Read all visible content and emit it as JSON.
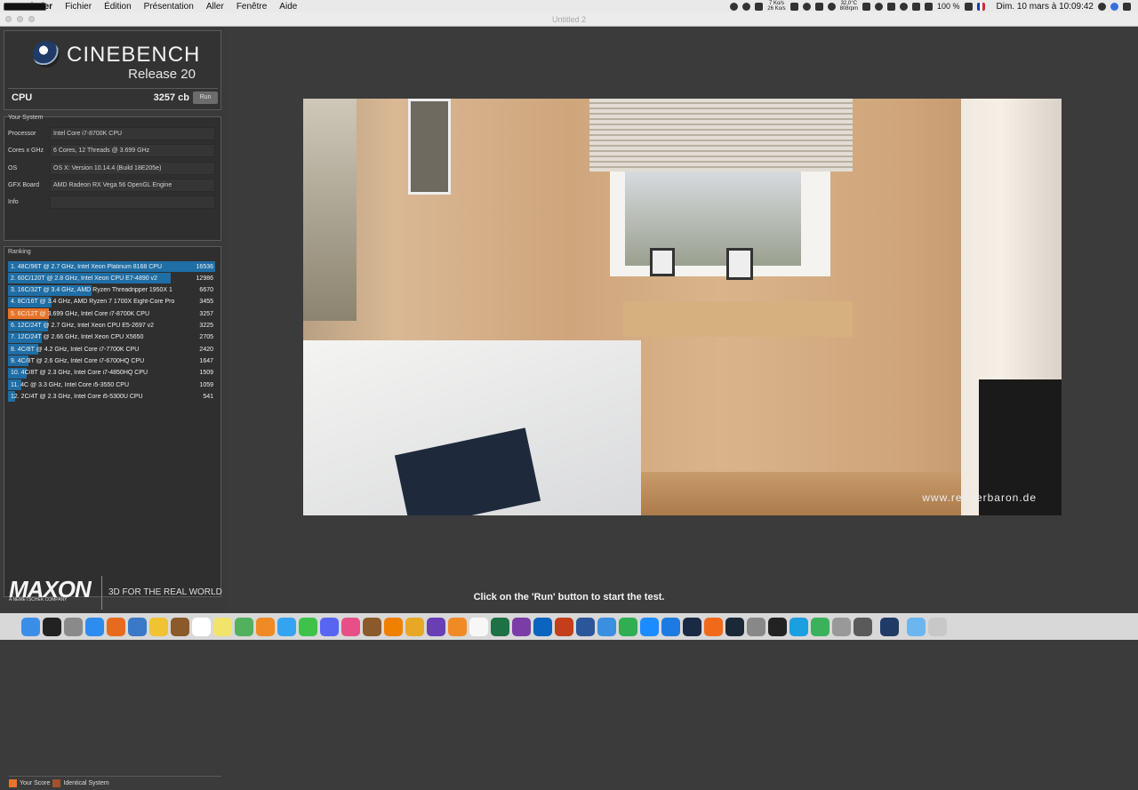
{
  "menubar": {
    "items": [
      "Finder",
      "Fichier",
      "Édition",
      "Présentation",
      "Aller",
      "Fenêtre",
      "Aide"
    ],
    "net": [
      "7 Ko/s",
      "26 Ko/s"
    ],
    "temp": [
      "32,0°C",
      "808rpm"
    ],
    "battery": "100 %",
    "clock": "Dim. 10 mars à  10:09:42"
  },
  "window": {
    "title": "Untitled 2"
  },
  "logo": {
    "name": "CINEBENCH",
    "release": "Release 20"
  },
  "cpu": {
    "label": "CPU",
    "score": "3257 cb",
    "run_label": "Run"
  },
  "system": {
    "title": "Your System",
    "rows": [
      {
        "label": "Processor",
        "value": "Intel Core i7-8700K CPU"
      },
      {
        "label": "Cores x GHz",
        "value": "6 Cores, 12 Threads @ 3.699 GHz"
      },
      {
        "label": "OS",
        "value": "OS X: Version 10.14.4 (Build 18E205e)"
      },
      {
        "label": "GFX Board",
        "value": "AMD Radeon RX Vega 56 OpenGL Engine"
      },
      {
        "label": "Info",
        "value": ""
      }
    ]
  },
  "ranking": {
    "title": "Ranking",
    "max": 16536,
    "rows": [
      {
        "text": "1. 48C/96T @ 2.7 GHz, Intel Xeon Platinum 8168 CPU",
        "score": "16536",
        "value": 16536,
        "own": false
      },
      {
        "text": "2. 60C/120T @ 2.8 GHz, Intel Xeon CPU E7-4890 v2",
        "score": "12986",
        "value": 12986,
        "own": false
      },
      {
        "text": "3. 16C/32T @ 3.4 GHz, AMD Ryzen Threadripper 1950X 1",
        "score": "6670",
        "value": 6670,
        "own": false
      },
      {
        "text": "4. 8C/16T @ 3.4 GHz, AMD Ryzen 7 1700X Eight-Core Pro",
        "score": "3455",
        "value": 3455,
        "own": false
      },
      {
        "text": "5. 6C/12T @ 3.699 GHz, Intel Core i7-8700K CPU",
        "score": "3257",
        "value": 3257,
        "own": true
      },
      {
        "text": "6. 12C/24T @ 2.7 GHz, Intel Xeon CPU E5-2697 v2",
        "score": "3225",
        "value": 3225,
        "own": false
      },
      {
        "text": "7. 12C/24T @ 2.66 GHz, Intel Xeon CPU X5650",
        "score": "2705",
        "value": 2705,
        "own": false
      },
      {
        "text": "8. 4C/8T @ 4.2 GHz, Intel Core i7-7700K CPU",
        "score": "2420",
        "value": 2420,
        "own": false
      },
      {
        "text": "9. 4C/8T @ 2.6 GHz, Intel Core i7-6700HQ CPU",
        "score": "1647",
        "value": 1647,
        "own": false
      },
      {
        "text": "10. 4C/8T @ 2.3 GHz, Intel Core i7-4850HQ CPU",
        "score": "1509",
        "value": 1509,
        "own": false
      },
      {
        "text": "11. 4C @ 3.3 GHz, Intel Core i5-3550 CPU",
        "score": "1059",
        "value": 1059,
        "own": false
      },
      {
        "text": "12. 2C/4T @ 2.3 GHz, Intel Core i5-5300U CPU",
        "score": "541",
        "value": 541,
        "own": false
      }
    ]
  },
  "legend": {
    "your_score": "Your Score",
    "identical": "Identical System",
    "your_color": "#e8742a",
    "identical_color": "#a0522d"
  },
  "maxon": {
    "name": "MAXON",
    "sub": "A NEMETSCHEK COMPANY",
    "tagline": "3D FOR THE REAL WORLD"
  },
  "render": {
    "watermark": "www.renderbaron.de"
  },
  "status": "Click on the 'Run' button to start the test.",
  "dock": {
    "icons": [
      "finder-icon",
      "siri-icon",
      "launchpad-icon",
      "safari-icon",
      "firefox-icon",
      "preview-icon",
      "photos-icon",
      "notes-icon",
      "calendar-icon",
      "stickies-icon",
      "maps-icon",
      "pinwheel-icon",
      "messages-icon",
      "facetime-icon",
      "discord-icon",
      "itunes-icon",
      "guitar-icon",
      "vlc-icon",
      "app-icon",
      "imovie-icon",
      "books-icon",
      "pages-doc-icon",
      "excel-icon",
      "onenote-icon",
      "outlook-icon",
      "powerpoint-icon",
      "word-icon",
      "keynote-icon",
      "numbers-icon",
      "appstore-icon",
      "xcode-icon",
      "cinema4d-icon",
      "app-icon-2",
      "steam-icon",
      "system-prefs-icon",
      "terminal-icon",
      "network-icon",
      "activity-icon",
      "scanner-icon",
      "screen-icon",
      "cinebench-icon",
      "folder-icon",
      "trash-icon"
    ],
    "colors": [
      "#3b8ee8",
      "#222",
      "#8a8a8a",
      "#2d8cf0",
      "#e86a1e",
      "#3a78c8",
      "#f1c232",
      "#8a5a2b",
      "#ffffff",
      "#f2e36b",
      "#53b05c",
      "#f08a24",
      "#35a4f0",
      "#3ec24a",
      "#5865f2",
      "#e84f87",
      "#8b5a2b",
      "#f08000",
      "#e8a825",
      "#6a3fb5",
      "#f08a24",
      "#f7f7f7",
      "#1e7145",
      "#7a3da8",
      "#0a64c0",
      "#c43e1c",
      "#2b579a",
      "#3a8fe0",
      "#2fae52",
      "#1a8cff",
      "#1d7ae0",
      "#1b2a44",
      "#f06a1a",
      "#1b2838",
      "#888888",
      "#222222",
      "#1a9fe0",
      "#3bb15b",
      "#999999",
      "#5a5a5a",
      "#1f3b66",
      "#6cb6f0",
      "#c8c8c8"
    ]
  }
}
